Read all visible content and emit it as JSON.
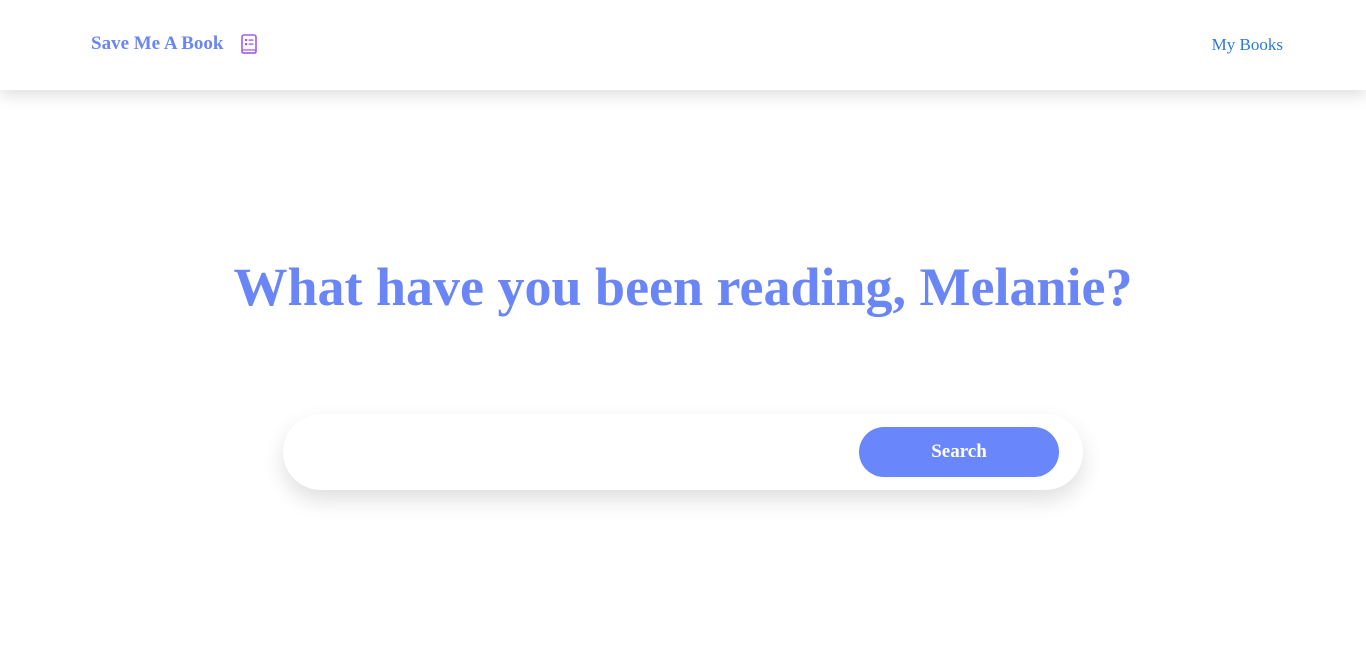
{
  "header": {
    "brand_label": "Save Me A Book",
    "brand_icon": "book-list-icon",
    "nav_link_label": "My Books"
  },
  "main": {
    "title": "What have you been reading, Melanie?"
  },
  "search": {
    "value": "",
    "placeholder": "",
    "button_label": "Search"
  },
  "colors": {
    "accent": "#6a86f6",
    "link": "#2a7bd6",
    "icon": "#a45ce8",
    "background": "#ffffff"
  }
}
